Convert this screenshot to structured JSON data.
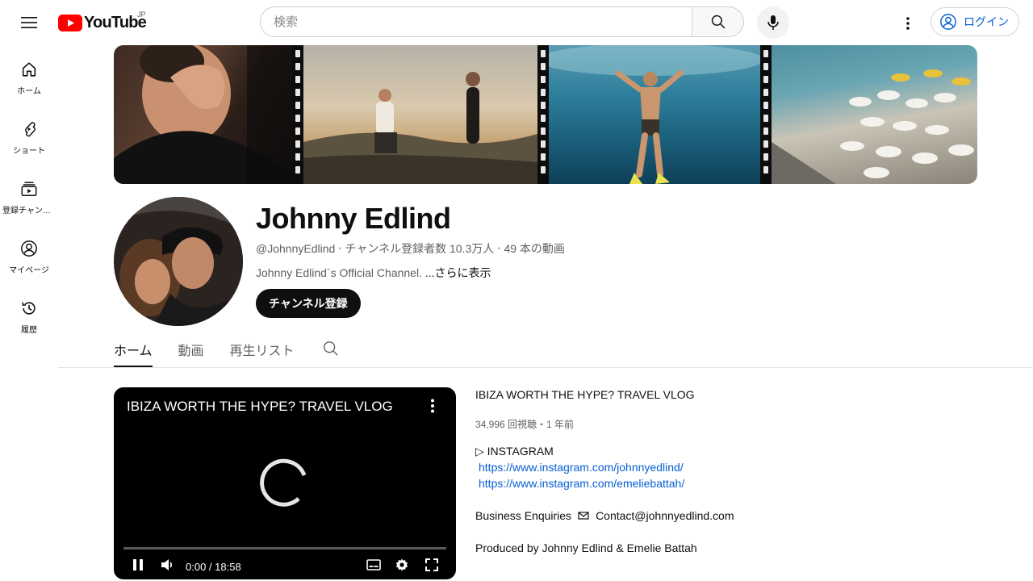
{
  "header": {
    "logo_text": "YouTube",
    "region": "JP",
    "search": {
      "placeholder": "検索",
      "value": ""
    },
    "login_label": "ログイン"
  },
  "guide": {
    "items": [
      {
        "label": "ホーム",
        "icon": "home-icon"
      },
      {
        "label": "ショート",
        "icon": "shorts-icon"
      },
      {
        "label": "登録チャンネル",
        "icon": "subscriptions-icon"
      },
      {
        "label": "マイページ",
        "icon": "you-icon"
      },
      {
        "label": "履歴",
        "icon": "history-icon"
      }
    ]
  },
  "channel": {
    "name": "Johnny Edlind",
    "handle": "@JohnnyEdlind",
    "subscribers": "チャンネル登録者数 10.3万人",
    "video_count": "49 本の動画",
    "description": "Johnny Edlind´s Official Channel. ",
    "more_label": "...さらに表示",
    "subscribe_label": "チャンネル登録"
  },
  "tabs": [
    {
      "label": "ホーム",
      "active": true
    },
    {
      "label": "動画",
      "active": false
    },
    {
      "label": "再生リスト",
      "active": false
    }
  ],
  "player": {
    "title": "IBIZA WORTH THE HYPE? TRAVEL VLOG",
    "time": "0:00 / 18:58",
    "progress": 0
  },
  "featured": {
    "title": "IBIZA WORTH THE HYPE? TRAVEL VLOG",
    "stats": "34,996 回視聴・1 年前",
    "instagram_label": "▷ INSTAGRAM",
    "links": [
      "https://www.instagram.com/johnnyedlind/",
      "https://www.instagram.com/emeliebattah/"
    ],
    "business_label": "Business Enquiries",
    "business_email": "Contact@johnnyedlind.com",
    "produced_by": "Produced by Johnny Edlind & Emelie Battah"
  },
  "colors": {
    "brand_red": "#ff0000",
    "link_blue": "#065fd4",
    "text_primary": "#0f0f0f",
    "text_secondary": "#606060"
  }
}
